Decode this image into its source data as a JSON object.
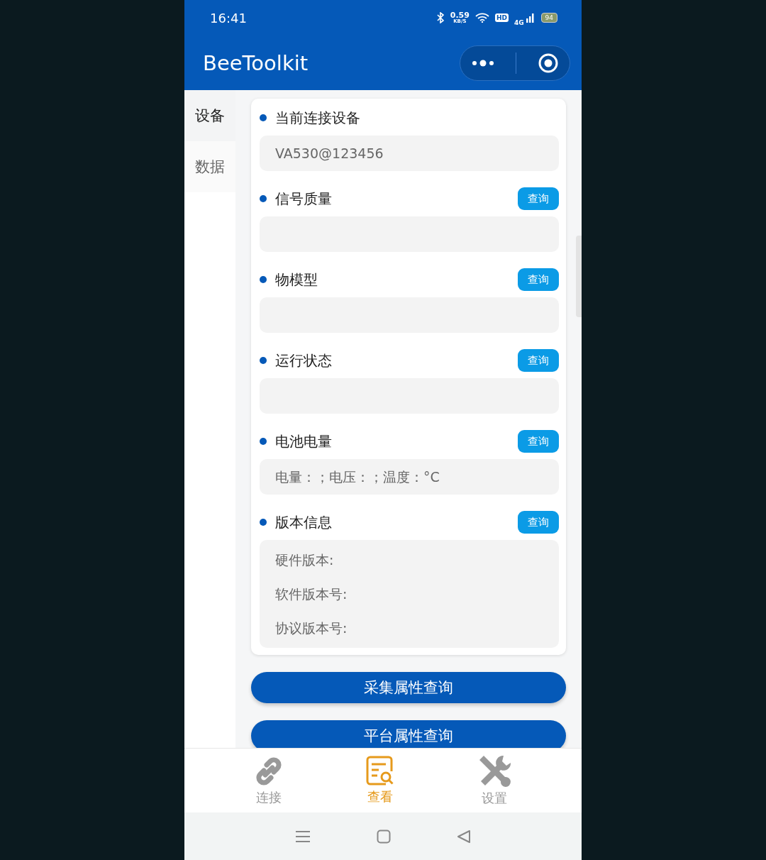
{
  "status_bar": {
    "time": "16:41",
    "speed": "0.59",
    "speed_unit": "KB/S",
    "hd": "HD",
    "network": "4G",
    "battery": "94"
  },
  "header": {
    "title": "BeeToolkit"
  },
  "sidebar": {
    "items": [
      {
        "label": "设备",
        "selected": true
      },
      {
        "label": "数据",
        "selected": false
      }
    ]
  },
  "sections": [
    {
      "title": "当前连接设备",
      "kind": "value",
      "lines": [
        "VA530@123456"
      ]
    },
    {
      "title": "信号质量",
      "button": "查询",
      "kind": "empty"
    },
    {
      "title": "物模型",
      "button": "查询",
      "kind": "empty"
    },
    {
      "title": "运行状态",
      "button": "查询",
      "kind": "empty"
    },
    {
      "title": "电池电量",
      "button": "查询",
      "kind": "value",
      "lines": [
        "电量：；电压：；温度：°C"
      ]
    },
    {
      "title": "版本信息",
      "button": "查询",
      "kind": "lines",
      "lines": [
        "硬件版本:",
        "软件版本号:",
        "协议版本号:"
      ]
    }
  ],
  "actions": [
    "采集属性查询",
    "平台属性查询"
  ],
  "tab_bar": [
    {
      "label": "连接",
      "kind": "link",
      "selected": false
    },
    {
      "label": "查看",
      "kind": "view",
      "selected": true
    },
    {
      "label": "设置",
      "kind": "tools",
      "selected": false
    }
  ]
}
